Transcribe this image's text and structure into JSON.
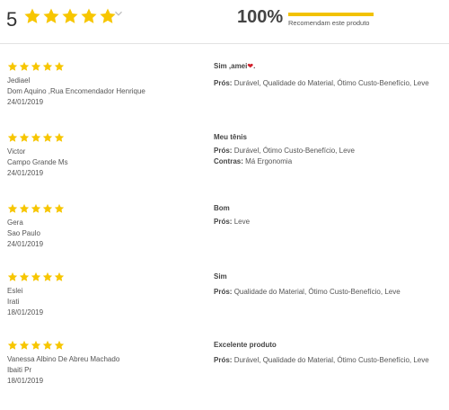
{
  "summary": {
    "average": "5",
    "rating": 5,
    "recommend_percent": "100%",
    "recommend_value": 100,
    "recommend_label": "Recomendam este produto",
    "star_color": "#F7C600",
    "bar_color": "#F2C200"
  },
  "labels": {
    "pros": "Prós:",
    "cons": "Contras:"
  },
  "reviews": [
    {
      "rating": 5,
      "author": "Jediael",
      "location": "Dom Aquino ,Rua Encomendador Henrique",
      "date": "24/01/2019",
      "title": "Sim ,amei",
      "title_suffix": ".",
      "pros": "Durável, Qualidade do Material, Ótimo Custo-Benefício, Leve",
      "cons": ""
    },
    {
      "rating": 5,
      "author": "Victor",
      "location": "Campo Grande Ms",
      "date": "24/01/2019",
      "title": "Meu tênis",
      "pros": "Durável, Ótimo Custo-Benefício, Leve",
      "cons": "Má Ergonomia"
    },
    {
      "rating": 5,
      "author": "Gera",
      "location": "Sao Paulo",
      "date": "24/01/2019",
      "title": "Bom",
      "pros": "Leve",
      "cons": ""
    },
    {
      "rating": 5,
      "author": "Eslei",
      "location": "Irati",
      "date": "18/01/2019",
      "title": "Sim",
      "pros": "Qualidade do Material, Ótimo Custo-Benefício, Leve",
      "cons": ""
    },
    {
      "rating": 5,
      "author": "Vanessa Albino De Abreu Machado",
      "location": "Ibaiti Pr",
      "date": "18/01/2019",
      "title": "Excelente produto",
      "pros": "Durável, Qualidade do Material, Ótimo Custo-Benefício, Leve",
      "cons": ""
    }
  ]
}
